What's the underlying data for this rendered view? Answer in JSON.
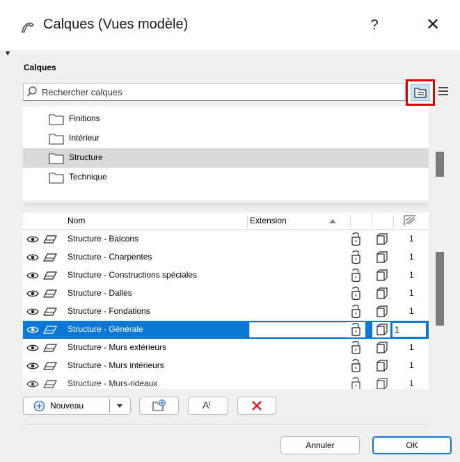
{
  "window": {
    "title": "Calques (Vues modèle)",
    "help_label": "?",
    "close_label": "✕"
  },
  "section_label": "Calques",
  "search": {
    "placeholder": "Rechercher calques",
    "value": ""
  },
  "folders": [
    {
      "label": "Finitions",
      "selected": false
    },
    {
      "label": "Intérieur",
      "selected": false
    },
    {
      "label": "Structure",
      "selected": true
    },
    {
      "label": "Technique",
      "selected": false
    }
  ],
  "table": {
    "headers": {
      "name": "Nom",
      "extension": "Extension"
    },
    "rows": [
      {
        "name": "Structure - Balcons",
        "num": "1",
        "selected": false
      },
      {
        "name": "Structure - Charpentes",
        "num": "1",
        "selected": false
      },
      {
        "name": "Structure - Constructions spéciales",
        "num": "1",
        "selected": false
      },
      {
        "name": "Structure - Dalles",
        "num": "1",
        "selected": false
      },
      {
        "name": "Structure - Fondations",
        "num": "1",
        "selected": false
      },
      {
        "name": "Structure - Générale",
        "num": "1",
        "selected": true
      },
      {
        "name": "Structure - Murs extérieurs",
        "num": "1",
        "selected": false
      },
      {
        "name": "Structure - Murs intérieurs",
        "num": "1",
        "selected": false
      },
      {
        "name": "Structure - Murs-rideaux",
        "num": "1",
        "selected": false
      }
    ]
  },
  "buttons": {
    "new_label": "Nouveau",
    "rename_label": "Aᴵ",
    "cancel_label": "Annuler",
    "ok_label": "OK"
  },
  "colors": {
    "selection": "#0a78d7",
    "highlight_border": "#e00000",
    "delete": "#e81123"
  }
}
